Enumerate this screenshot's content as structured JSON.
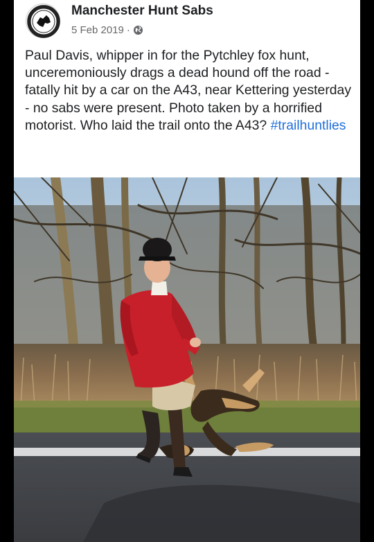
{
  "post": {
    "page_name": "Manchester Hunt Sabs",
    "date": "5 Feb 2019",
    "separator": "·",
    "privacy_icon": "globe-icon",
    "text": "Paul Davis, whipper in for the Pytchley fox hunt, unceremoniously drags a dead hound off the road - fatally hit by a car on the A43, near Kettering yesterday - no sabs were present. Photo taken by a horrified motorist. Who laid the trail onto the A43?",
    "hashtag": "#trailhuntlies"
  },
  "avatar_icon": "hunt-sabs-logo",
  "colors": {
    "link": "#216fdb",
    "name": "#1c1e21",
    "meta": "#65676b",
    "coat": "#c8202a"
  }
}
